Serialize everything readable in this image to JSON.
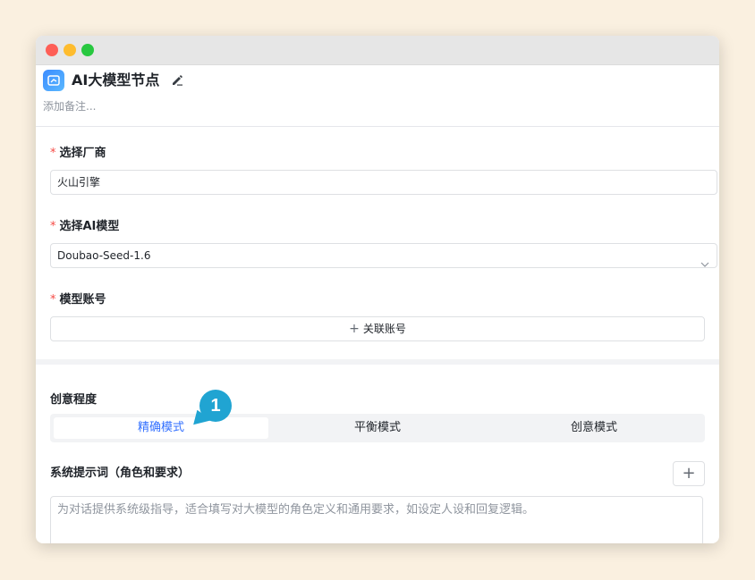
{
  "window": {
    "traffic_lights": [
      "close",
      "minimize",
      "maximize"
    ]
  },
  "header": {
    "title": "AI大模型节点",
    "remark_placeholder": "添加备注..."
  },
  "vendor": {
    "label": "选择厂商",
    "required_mark": "*",
    "value": "火山引擎"
  },
  "model": {
    "label": "选择AI模型",
    "required_mark": "*",
    "value": "Doubao-Seed-1.6"
  },
  "account": {
    "label": "模型账号",
    "required_mark": "*",
    "button_plus": "+",
    "button_label": "关联账号"
  },
  "creativity": {
    "label": "创意程度",
    "options": [
      "精确模式",
      "平衡模式",
      "创意模式"
    ],
    "selected": "精确模式",
    "step_badge": "1"
  },
  "system_prompt": {
    "label": "系统提示词（角色和要求）",
    "add_button": "+",
    "placeholder": "为对话提供系统级指导，适合填写对大模型的角色定义和通用要求，如设定人设和回复逻辑。"
  },
  "colors": {
    "accent": "#3370ff",
    "required": "#f54a45",
    "badge": "#20a4d2",
    "background": "#faf0e0"
  }
}
